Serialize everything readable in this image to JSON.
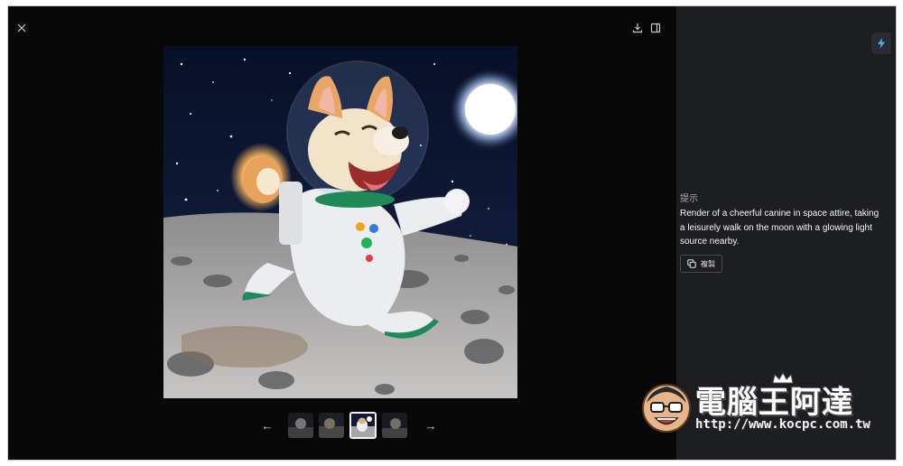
{
  "toolbar": {
    "close_icon": "close-icon",
    "download_icon": "download-icon",
    "sidebar_icon": "sidebar-toggle-icon"
  },
  "gallery": {
    "prev_icon": "arrow-left-icon",
    "next_icon": "arrow-right-icon",
    "prev_label": "←",
    "next_label": "→",
    "thumbnail_count": 4,
    "active_index": 2
  },
  "side_panel": {
    "quick_action_icon": "lightning-icon",
    "prompt_heading": "提示",
    "prompt_text": "Render of a cheerful canine in space attire, taking a leisurely walk on the moon with a glowing light source nearby.",
    "copy_label": "複製",
    "copy_icon": "copy-icon"
  },
  "watermark": {
    "title": "電腦王阿達",
    "url": "http://www.kocpc.com.tw"
  },
  "colors": {
    "viewer_bg": "#080809",
    "panel_bg": "#1d1e21",
    "accent": "#3fb8d9"
  }
}
